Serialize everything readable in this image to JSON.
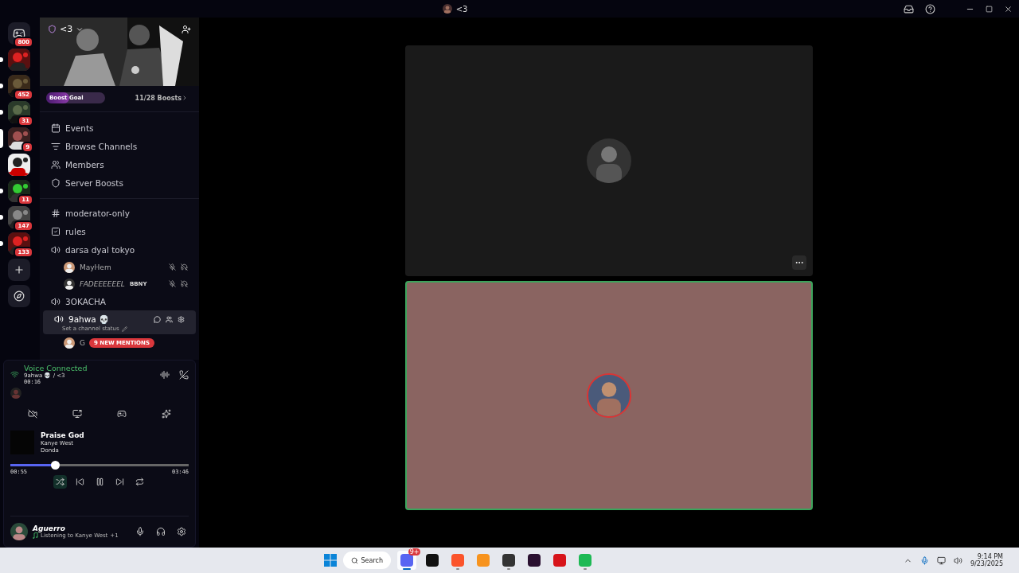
{
  "window": {
    "title": "<3"
  },
  "servers": [
    {
      "badge": "800",
      "kind": "home",
      "selected": false,
      "unread": false
    },
    {
      "kind": "picture",
      "selected": false,
      "unread": true
    },
    {
      "badge": "452",
      "kind": "picture",
      "selected": false,
      "unread": true
    },
    {
      "badge": "31",
      "kind": "picture",
      "selected": false,
      "unread": true
    },
    {
      "badge": "9",
      "kind": "picture",
      "selected": true,
      "unread": false
    },
    {
      "kind": "picture",
      "selected": false,
      "unread": false
    },
    {
      "badge": "11",
      "kind": "picture",
      "selected": false,
      "unread": true
    },
    {
      "badge": "147",
      "kind": "picture",
      "selected": false,
      "unread": true
    },
    {
      "badge": "133",
      "kind": "picture",
      "selected": false,
      "unread": true
    },
    {
      "kind": "add",
      "selected": false,
      "unread": false
    },
    {
      "kind": "discover",
      "selected": false,
      "unread": false
    }
  ],
  "server": {
    "name": "<3"
  },
  "boost": {
    "label": "Boost Goal",
    "count": "11/28 Boosts",
    "level": 0.39
  },
  "menu": [
    {
      "kind": "events",
      "label": "Events"
    },
    {
      "kind": "browse",
      "label": "Browse Channels"
    },
    {
      "kind": "members",
      "label": "Members"
    },
    {
      "kind": "boosts",
      "label": "Server Boosts"
    }
  ],
  "channels": [
    {
      "kind": "text",
      "name": "moderator-only",
      "selected": false
    },
    {
      "kind": "rules",
      "name": "rules",
      "selected": false
    },
    {
      "kind": "voice",
      "name": "darsa dyal tokyo",
      "selected": false,
      "children": [
        {
          "name": "MayHem",
          "muted": true,
          "deafened": true
        },
        {
          "name": "FADEEEEEEL",
          "tag": "BBNY",
          "muted": true,
          "deafened": true
        }
      ]
    },
    {
      "kind": "voice",
      "name": "3OKACHA",
      "selected": false
    },
    {
      "kind": "voice",
      "name": "9ahwa 💀",
      "status": "Set a channel status",
      "selected": true,
      "children": [
        {
          "name": "G",
          "muted": false,
          "deafened": false
        }
      ]
    }
  ],
  "mentions": "9 NEW MENTIONS",
  "voice": {
    "label": "Voice Connected",
    "channel": "9ahwa 💀 / <3",
    "time": "00:16"
  },
  "music": {
    "title": "Praise God",
    "artist": "Kanye West",
    "album": "Donda",
    "elapsed": "00:55",
    "total": "03:46",
    "level": 0.25,
    "shuffle": true
  },
  "user": {
    "name": "Aguerro",
    "activity": "Listening to Kanye West",
    "extra": "+1"
  },
  "call": {
    "tiles": [
      {
        "speaking": false
      },
      {
        "speaking": true
      }
    ]
  },
  "taskbar": {
    "search": "Search",
    "apps": [
      {
        "color": "#5865f2",
        "badge": "9+",
        "running": true,
        "active": true
      },
      {
        "color": "#111111",
        "running": false,
        "active": false
      },
      {
        "color": "#fb542b",
        "running": true,
        "active": false
      },
      {
        "color": "#f7931e",
        "running": false,
        "active": false
      },
      {
        "color": "#333333",
        "running": true,
        "active": false
      },
      {
        "color": "#2a1030",
        "running": false,
        "active": false
      },
      {
        "color": "#d7141a",
        "running": false,
        "active": false
      },
      {
        "color": "#1db954",
        "running": true,
        "active": false
      }
    ],
    "time": "9:14 PM",
    "date": "9/23/2025"
  }
}
